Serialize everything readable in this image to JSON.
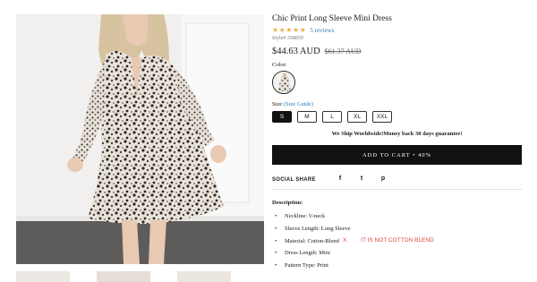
{
  "product": {
    "title": "Chic Print Long Sleeve Mini Dress",
    "stars": "★★★★★",
    "reviews_label": "5 reviews",
    "style_number": "Style# 358859",
    "price": "$44.63 AUD",
    "original_price": "$61.37 AUD",
    "color_label": "Color:",
    "size_label": "Size",
    "size_guide_label": "(Size Guide)",
    "sizes": [
      "S",
      "M",
      "L",
      "XL",
      "XXL"
    ],
    "selected_size": "S",
    "shipping_note": "We Ship Worldwide!Money back 30 days guarantee!",
    "add_to_cart_label": "ADD TO CART • 40%"
  },
  "share": {
    "label": "SOCIAL SHARE",
    "icons": [
      {
        "name": "facebook-icon",
        "glyph": "f"
      },
      {
        "name": "twitter-icon",
        "glyph": "t"
      },
      {
        "name": "pinterest-icon",
        "glyph": "p"
      }
    ]
  },
  "description": {
    "label": "Description:",
    "items": [
      "Neckline: V-neck",
      "Sleeve Length: Long Sleeve",
      "Material: Cotton-Blend",
      "Dress Length: Mini",
      "Pattern Type: Print"
    ],
    "annotation_mark": "X",
    "annotation_text": "IT IS NOT COTTON BLEND"
  },
  "colors": {
    "accent_link": "#2d7bb5",
    "star": "#e8b24a",
    "annotation": "#e0483b",
    "button": "#111111"
  }
}
